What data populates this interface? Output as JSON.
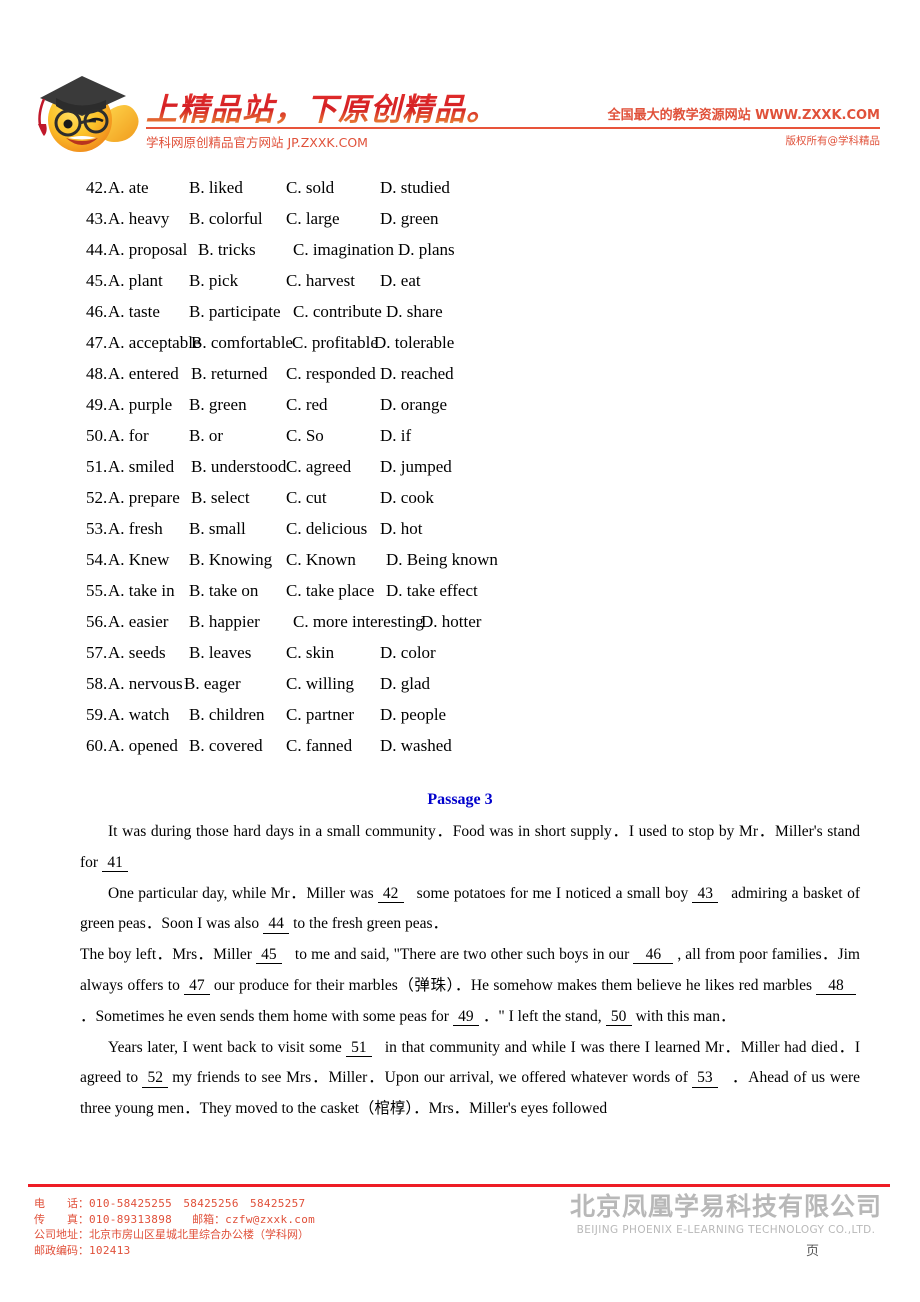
{
  "header": {
    "slogan": "上精品站，下原创精品。",
    "subtitle_left": "学科网原创精品官方网站 JP.ZXXK.COM",
    "site_line": "全国最大的教学资源网站 WWW.ZXXK.COM",
    "copyright_right": "版权所有@学科精品"
  },
  "questions": [
    {
      "num": "42.",
      "a": "A. ate",
      "b": "B. liked",
      "c": "C. sold",
      "d": "D. studied"
    },
    {
      "num": "43.",
      "a": "A. heavy",
      "b": "B. colorful",
      "c": "C. large",
      "d": "D. green"
    },
    {
      "num": "44.",
      "a": "A. proposal",
      "b": "B. tricks",
      "c": "C. imagination",
      "d": "D. plans"
    },
    {
      "num": "45.",
      "a": "A. plant",
      "b": "B. pick",
      "c": "C. harvest",
      "d": "D. eat"
    },
    {
      "num": "46.",
      "a": "A. taste",
      "b": "B. participate",
      "c": "C. contribute",
      "d": "D. share"
    },
    {
      "num": "47.",
      "a": "A. acceptable",
      "b": "B. comfortable",
      "c": "C. profitable",
      "d": "D. tolerable"
    },
    {
      "num": "48.",
      "a": "A. entered",
      "b": "B. returned",
      "c": "C. responded",
      "d": "D. reached"
    },
    {
      "num": "49.",
      "a": "A. purple",
      "b": "B. green",
      "c": "C. red",
      "d": "D. orange"
    },
    {
      "num": "50.",
      "a": "A. for",
      "b": "B. or",
      "c": "C. So",
      "d": "D. if"
    },
    {
      "num": "51.",
      "a": "A. smiled",
      "b": "B. understood",
      "c": "C. agreed",
      "d": "D. jumped"
    },
    {
      "num": "52.",
      "a": "A. prepare",
      "b": "B. select",
      "c": "C. cut",
      "d": "D. cook"
    },
    {
      "num": "53.",
      "a": "A. fresh",
      "b": "B. small",
      "c": "C. delicious",
      "d": "D. hot"
    },
    {
      "num": "54.",
      "a": "A. Knew",
      "b": "B. Knowing",
      "c": "C. Known",
      "d": "D. Being known"
    },
    {
      "num": "55.",
      "a": "A. take in",
      "b": "B. take on",
      "c": "C. take place",
      "d": "D. take effect"
    },
    {
      "num": "56.",
      "a": "A. easier",
      "b": "B. happier",
      "c": "C. more interesting",
      "d": "D. hotter"
    },
    {
      "num": "57.",
      "a": "A. seeds",
      "b": "B. leaves",
      "c": "C. skin",
      "d": "D. color"
    },
    {
      "num": "58.",
      "a": "A. nervous",
      "b": "B. eager",
      "c": "C. willing",
      "d": "D. glad"
    },
    {
      "num": "59.",
      "a": "A. watch",
      "b": "B. children",
      "c": "C. partner",
      "d": "D. people"
    },
    {
      "num": "60.",
      "a": "A. opened",
      "b": "B. covered",
      "c": "C. fanned",
      "d": "D. washed"
    }
  ],
  "passage": {
    "title": "Passage 3",
    "p1_t1": "It was during those hard days in a small community．Food was in short supply．I used to stop by Mr．Miller's stand for",
    "p1_b1": "41",
    "p2_t1": "One particular day, while Mr．Miller was",
    "p2_b1": "42",
    "p2_t2": "some potatoes for me I noticed a small boy",
    "p2_b2": "43",
    "p2_t3": "admiring a basket of green peas．Soon I was also",
    "p2_b3": "44",
    "p2_t4": "to the fresh green peas．",
    "p3_t1": "The boy left．Mrs．Miller",
    "p3_b1": "45",
    "p3_t2": "to me and said, \"There are two other such boys in our",
    "p3_b2": "46",
    "p3_t3": ", all from poor families．Jim always offers to",
    "p3_b3": "47",
    "p3_t4": "our produce for their marbles（弹珠）．He somehow makes them believe he likes red marbles",
    "p3_b4": "48",
    "p3_t5": "．Sometimes he even sends them home with some peas for",
    "p3_b5": "49",
    "p3_t6": "．\" I left the stand,",
    "p3_b6": "50",
    "p3_t7": "with this man．",
    "p4_t1": "Years later, I went back to visit some",
    "p4_b1": "51",
    "p4_t2": "in that community and while I was there I learned Mr．Miller had died．I agreed to",
    "p4_b2": "52",
    "p4_t3": "my friends to see Mrs．Miller．Upon our arrival, we offered whatever words of",
    "p4_b3": "53",
    "p4_t4": "．Ahead of us were three young men．They moved to the casket（棺椁）．Mrs．Miller's eyes followed"
  },
  "footer": {
    "phone_label": "电　　话：",
    "phone_value": "010-58425255　58425256　58425257",
    "fax_label": "传　　真：",
    "fax_value": "010-89313898",
    "email_label": "邮箱：",
    "email_value": "czfw@zxxk.com",
    "address_label": "公司地址：",
    "address_value": "北京市房山区星城北里综合办公楼（学科网）",
    "zip_label": "邮政编码：",
    "zip_value": "102413",
    "watermark_cn": "北京凤凰学易科技有限公司",
    "watermark_en": "BEIJING PHOENIX E-LEARNING TECHNOLOGY CO.,LTD.",
    "page_marker": "页"
  },
  "colors": {
    "brand_red": "#e0503a",
    "rule_red": "#ee1c25",
    "passage_blue": "#0000cc",
    "watermark_gray": "#b8b8b8"
  }
}
